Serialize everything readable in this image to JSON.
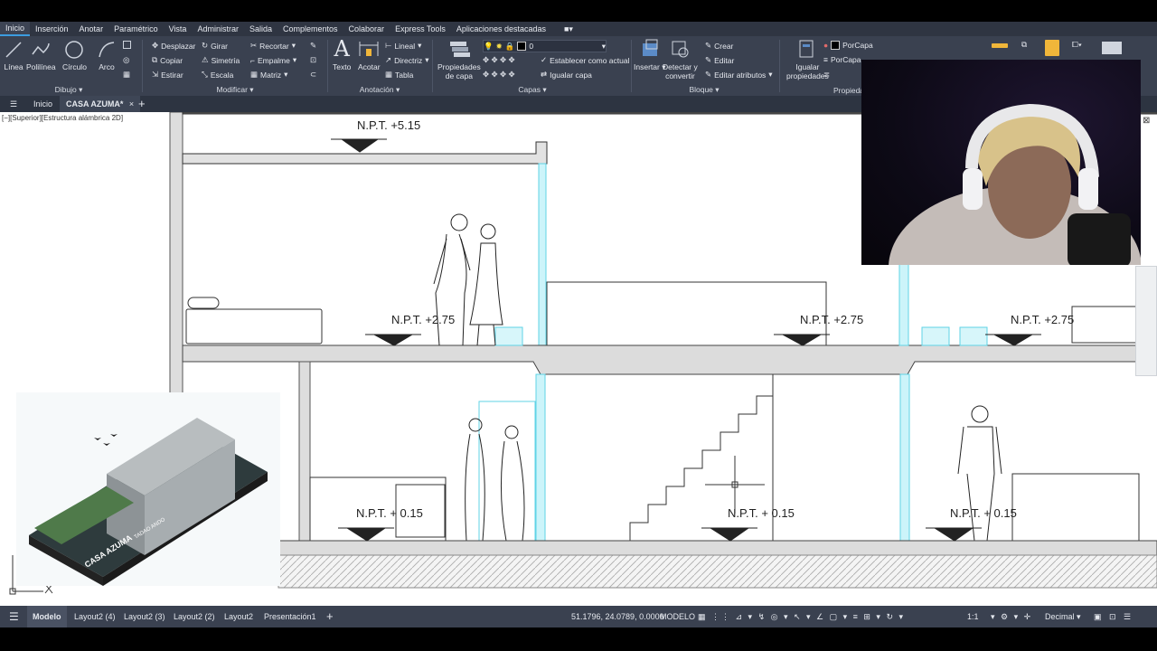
{
  "menu": {
    "items": [
      "Inicio",
      "Inserción",
      "Anotar",
      "Paramétrico",
      "Vista",
      "Administrar",
      "Salida",
      "Complementos",
      "Colaborar",
      "Express Tools",
      "Aplicaciones destacadas"
    ],
    "active": "Inicio"
  },
  "ribbon": {
    "draw": {
      "title": "Dibujo",
      "linea": "Línea",
      "polilinea": "Polilínea",
      "circulo": "Círculo",
      "arco": "Arco"
    },
    "modify": {
      "title": "Modificar",
      "desplazar": "Desplazar",
      "girar": "Girar",
      "recortar": "Recortar",
      "copiar": "Copiar",
      "simetria": "Simetría",
      "empalme": "Empalme",
      "estirar": "Estirar",
      "escala": "Escala",
      "matriz": "Matriz"
    },
    "annotation": {
      "title": "Anotación",
      "texto": "Texto",
      "acotar": "Acotar",
      "lineal": "Lineal",
      "directriz": "Directriz",
      "tabla": "Tabla"
    },
    "layers": {
      "title": "Capas",
      "propiedades_line1": "Propiedades",
      "propiedades_line2": "de capa",
      "current_layer": "0",
      "establecer": "Establecer como actual",
      "igualar": "Igualar capa"
    },
    "block": {
      "title": "Bloque",
      "insertar": "Insertar",
      "detectar_line1": "Detectar y",
      "detectar_line2": "convertir",
      "crear": "Crear",
      "editar": "Editar",
      "editar_atributos": "Editar atributos"
    },
    "properties": {
      "title": "Propiedades",
      "igualar_line1": "Igualar",
      "igualar_line2": "propiedades",
      "porcapa1": "PorCapa",
      "porcapa2": "PorCapa"
    }
  },
  "tabs": {
    "inicio": "Inicio",
    "file": "CASA AZUMA*",
    "add": "+"
  },
  "viewport_label": "[−][Superior][Estructura alámbrica 2D]",
  "drawing": {
    "levels": {
      "top": "N.P.T.  +5.15",
      "mid_left": "N.P.T.  +2.75",
      "mid_center": "N.P.T.  +2.75",
      "mid_right": "N.P.T.  +2.75",
      "low_left": "N.P.T.  + 0.15",
      "low_center": "N.P.T.  +  0.15",
      "low_right": "N.P.T.  + 0.15"
    }
  },
  "inset": {
    "caption": "CASA AZUMA",
    "subcaption": "TADAO ANDO"
  },
  "layouts": {
    "items": [
      "Modelo",
      "Layout2 (4)",
      "Layout2 (3)",
      "Layout2 (2)",
      "Layout2",
      "Presentación1"
    ],
    "active": "Modelo",
    "add": "+"
  },
  "status": {
    "coords": "51.1796, 24.0789, 0.0000",
    "mode": "MODELO",
    "scale": "1:1",
    "units": "Decimal"
  },
  "colors": {
    "menubar": "#2f3542",
    "ribbon": "#3a4150",
    "accent": "#3c9ce0",
    "cyan_lines": "#5fd3e6"
  }
}
